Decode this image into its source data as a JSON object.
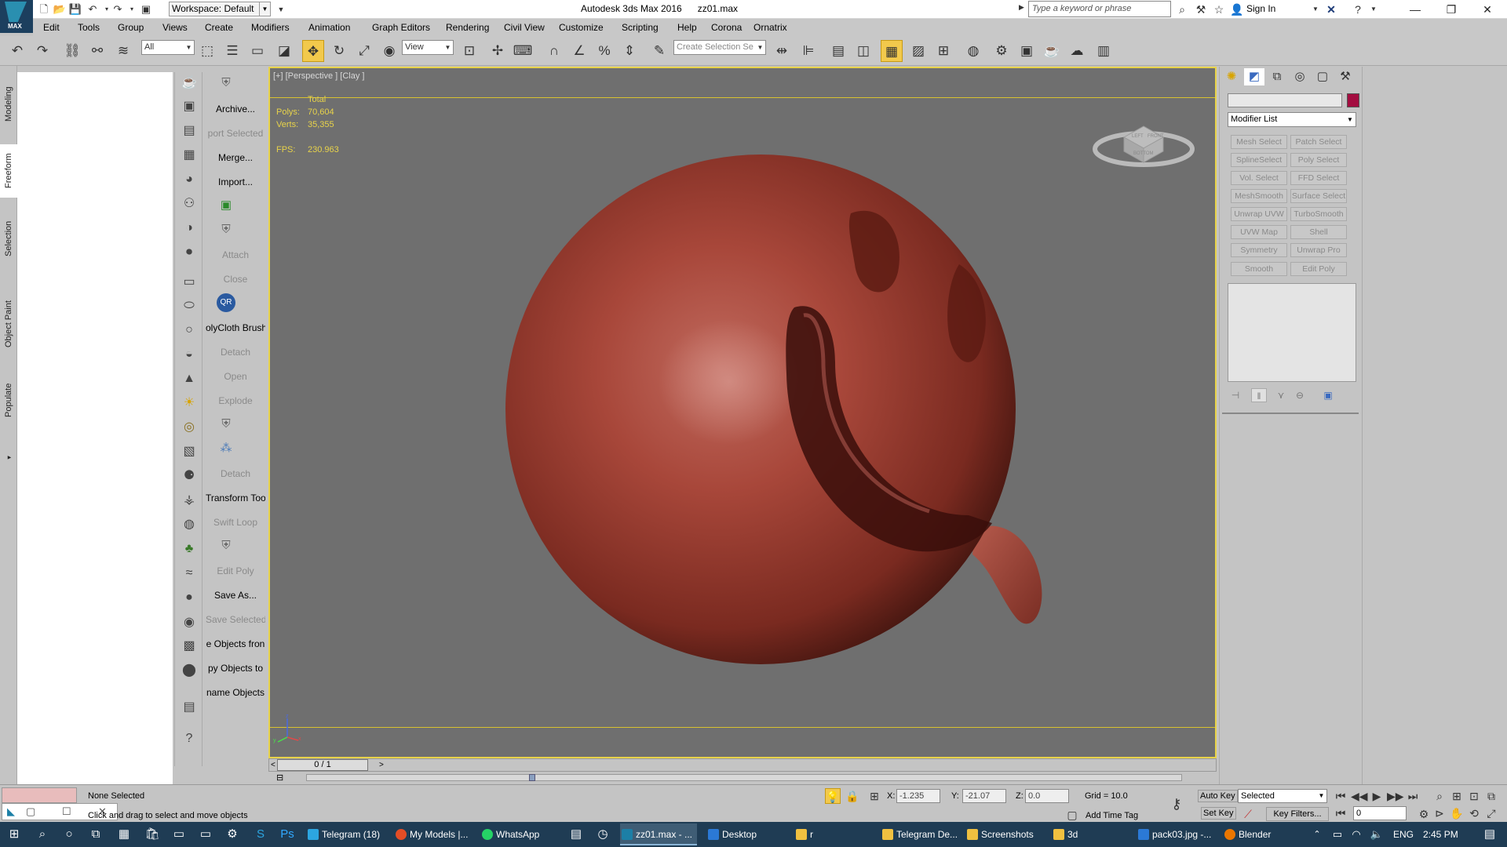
{
  "app": {
    "window_title": "Autodesk 3ds Max 2016",
    "file_name": "zz01.max",
    "logo_text": "MAX",
    "workspace": "Workspace: Default",
    "search_placeholder": "Type a keyword or phrase",
    "sign_in": "Sign In"
  },
  "menu": [
    "Edit",
    "Tools",
    "Group",
    "Views",
    "Create",
    "Modifiers",
    "Animation",
    "Graph Editors",
    "Rendering",
    "Civil View",
    "Customize",
    "Scripting",
    "Help",
    "Corona",
    "Ornatrix"
  ],
  "toolbar": {
    "selection_filter": "All",
    "reference_coord": "View",
    "named_selection": "Create Selection Se"
  },
  "ribbon_tabs": [
    "Modeling",
    "Freeform",
    "Selection",
    "Object Paint",
    "Populate"
  ],
  "command_column": [
    {
      "label": "Archive...",
      "disabled": false
    },
    {
      "label": "port Selected",
      "disabled": true
    },
    {
      "label": "Merge...",
      "disabled": false
    },
    {
      "label": "Import...",
      "disabled": false
    },
    {
      "label": "Attach",
      "disabled": true
    },
    {
      "label": "Close",
      "disabled": true
    },
    {
      "label": "olyCloth Brush",
      "disabled": false
    },
    {
      "label": "Detach",
      "disabled": true
    },
    {
      "label": "Open",
      "disabled": true
    },
    {
      "label": "Explode",
      "disabled": true
    },
    {
      "label": "Detach",
      "disabled": true
    },
    {
      "label": "Transform Tool",
      "disabled": false
    },
    {
      "label": "Swift Loop",
      "disabled": true
    },
    {
      "label": "Edit Poly",
      "disabled": true
    },
    {
      "label": "Save As...",
      "disabled": false
    },
    {
      "label": "Save Selected",
      "disabled": true
    },
    {
      "label": "e Objects fron",
      "disabled": false
    },
    {
      "label": "py Objects to",
      "disabled": false
    },
    {
      "label": "name Objects",
      "disabled": false
    }
  ],
  "viewport": {
    "label": "[+] [Perspective ] [Clay ]",
    "stats": {
      "total_label": "Total",
      "polys_label": "Polys:",
      "polys": "70,604",
      "verts_label": "Verts:",
      "verts": "35,355",
      "fps_label": "FPS:",
      "fps": "230.963"
    },
    "viewcube": {
      "left": "LEFT",
      "front": "FRONT",
      "bottom": "BOTTOM"
    },
    "axis": {
      "x": "x",
      "y": "y",
      "z": "z"
    }
  },
  "timeline": {
    "frame_display": "0 / 1",
    "prev": "<",
    "next": ">"
  },
  "command_panel": {
    "modifier_list": "Modifier List",
    "buttons": [
      "Mesh Select",
      "Patch Select",
      "SplineSelect",
      "Poly Select",
      "Vol. Select",
      "FFD Select",
      "MeshSmooth",
      "Surface Select",
      "Unwrap UVW",
      "TurboSmooth",
      "UVW Map",
      "Shell",
      "Symmetry",
      "Unwrap Pro",
      "Smooth",
      "Edit Poly"
    ],
    "object_color": "#a30d40"
  },
  "status": {
    "selection": "None Selected",
    "prompt": "Click and drag to select and move objects",
    "x_label": "X:",
    "x": "-1.235",
    "y_label": "Y:",
    "y": "-21.07",
    "z_label": "Z:",
    "z": "0.0",
    "grid": "Grid = 10.0",
    "add_time_tag": "Add Time Tag",
    "auto_key": "Auto Key",
    "set_key": "Set Key",
    "key_mode": "Selected",
    "key_filters": "Key Filters...",
    "frame": "0"
  },
  "taskbar": {
    "tasks": [
      {
        "label": "Telegram (18)",
        "color": "#2ca5e0",
        "active": false
      },
      {
        "label": "My Models |...",
        "color": "#e44d26",
        "active": false
      },
      {
        "label": "WhatsApp",
        "color": "#25d366",
        "active": false
      },
      {
        "label": "zz01.max - ...",
        "color": "#1c7fa6",
        "active": true
      },
      {
        "label": "Desktop",
        "color": "#2b79d6",
        "active": false
      },
      {
        "label": "r",
        "color": "#f0c040",
        "active": false
      },
      {
        "label": "Telegram De...",
        "color": "#f0c040",
        "active": false
      },
      {
        "label": "Screenshots",
        "color": "#f0c040",
        "active": false
      },
      {
        "label": "3d",
        "color": "#f0c040",
        "active": false
      },
      {
        "label": "pack03.jpg -...",
        "color": "#2b79d6",
        "active": false
      },
      {
        "label": "Blender",
        "color": "#ea7600",
        "active": false
      }
    ],
    "language": "ENG",
    "time": "2:45 PM"
  }
}
